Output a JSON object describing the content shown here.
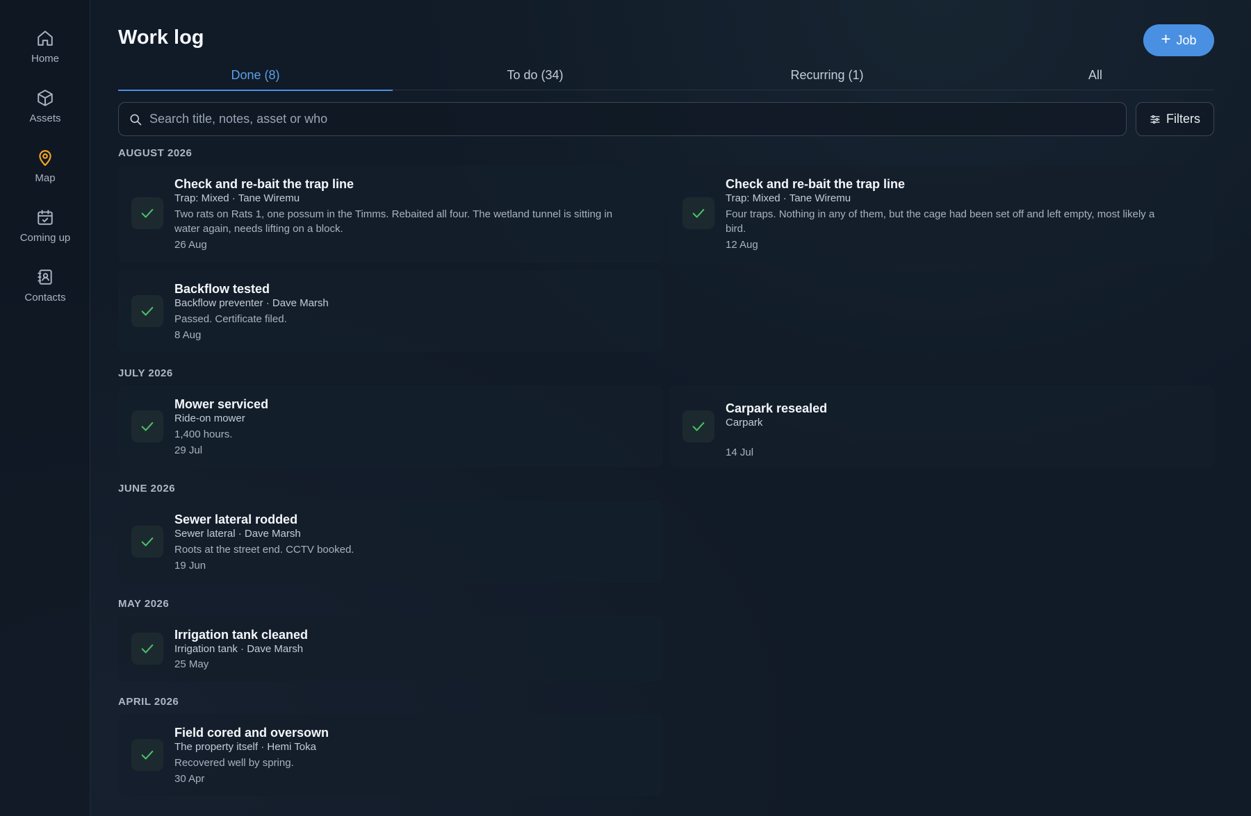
{
  "sidebar": {
    "items": [
      {
        "label": "Home",
        "icon": "home-icon"
      },
      {
        "label": "Assets",
        "icon": "cube-icon"
      },
      {
        "label": "Map",
        "icon": "map-pin-icon"
      },
      {
        "label": "Coming up",
        "icon": "calendar-check-icon"
      },
      {
        "label": "Contacts",
        "icon": "contacts-book-icon"
      }
    ],
    "accent_color": "#f5a623"
  },
  "header": {
    "title": "Work log",
    "job_button_label": "Job",
    "job_button_color": "#4a90e2"
  },
  "tabs": [
    {
      "label": "Done (8)",
      "active": true
    },
    {
      "label": "To do (34)",
      "active": false
    },
    {
      "label": "Recurring (1)",
      "active": false
    },
    {
      "label": "All",
      "active": false
    }
  ],
  "search": {
    "placeholder": "Search title, notes, asset or who",
    "value": ""
  },
  "filters_label": "Filters",
  "sections": [
    {
      "label": "AUGUST 2026",
      "entries": [
        {
          "title": "Check and re-bait the trap line",
          "meta": "Trap: Mixed · Tane Wiremu",
          "note_lines": [
            "Two rats on Rats 1, one possum in the Timms. Rebaited all four. The wetland tunnel is sitting in",
            "water again, needs lifting on a block."
          ],
          "date": "26 Aug"
        },
        {
          "title": "Check and re-bait the trap line",
          "meta": "Trap: Mixed · Tane Wiremu",
          "note_lines": [
            "Four traps. Nothing in any of them, but the cage had been set off and left empty, most likely a",
            "bird."
          ],
          "date": "12 Aug"
        },
        {
          "title": "Backflow tested",
          "meta": "Backflow preventer · Dave Marsh",
          "note_lines": [
            "Passed. Certificate filed."
          ],
          "date": "8 Aug"
        }
      ]
    },
    {
      "label": "JULY 2026",
      "entries": [
        {
          "title": "Mower serviced",
          "meta": "Ride-on mower",
          "note_lines": [
            "1,400 hours."
          ],
          "date": "29 Jul"
        },
        {
          "title": "Carpark resealed",
          "meta": "Carpark",
          "note_lines": [],
          "date": "14 Jul"
        }
      ]
    },
    {
      "label": "JUNE 2026",
      "entries": [
        {
          "title": "Sewer lateral rodded",
          "meta": "Sewer lateral · Dave Marsh",
          "note_lines": [
            "Roots at the street end. CCTV booked."
          ],
          "date": "19 Jun"
        }
      ]
    },
    {
      "label": "MAY 2026",
      "entries": [
        {
          "title": "Irrigation tank cleaned",
          "meta": "Irrigation tank · Dave Marsh",
          "note_lines": [],
          "date": "25 May"
        }
      ]
    },
    {
      "label": "APRIL 2026",
      "entries": [
        {
          "title": "Field cored and oversown",
          "meta": "The property itself · Hemi Toka",
          "note_lines": [
            "Recovered well by spring."
          ],
          "date": "30 Apr"
        }
      ]
    }
  ],
  "check_color": "#4cc36a"
}
